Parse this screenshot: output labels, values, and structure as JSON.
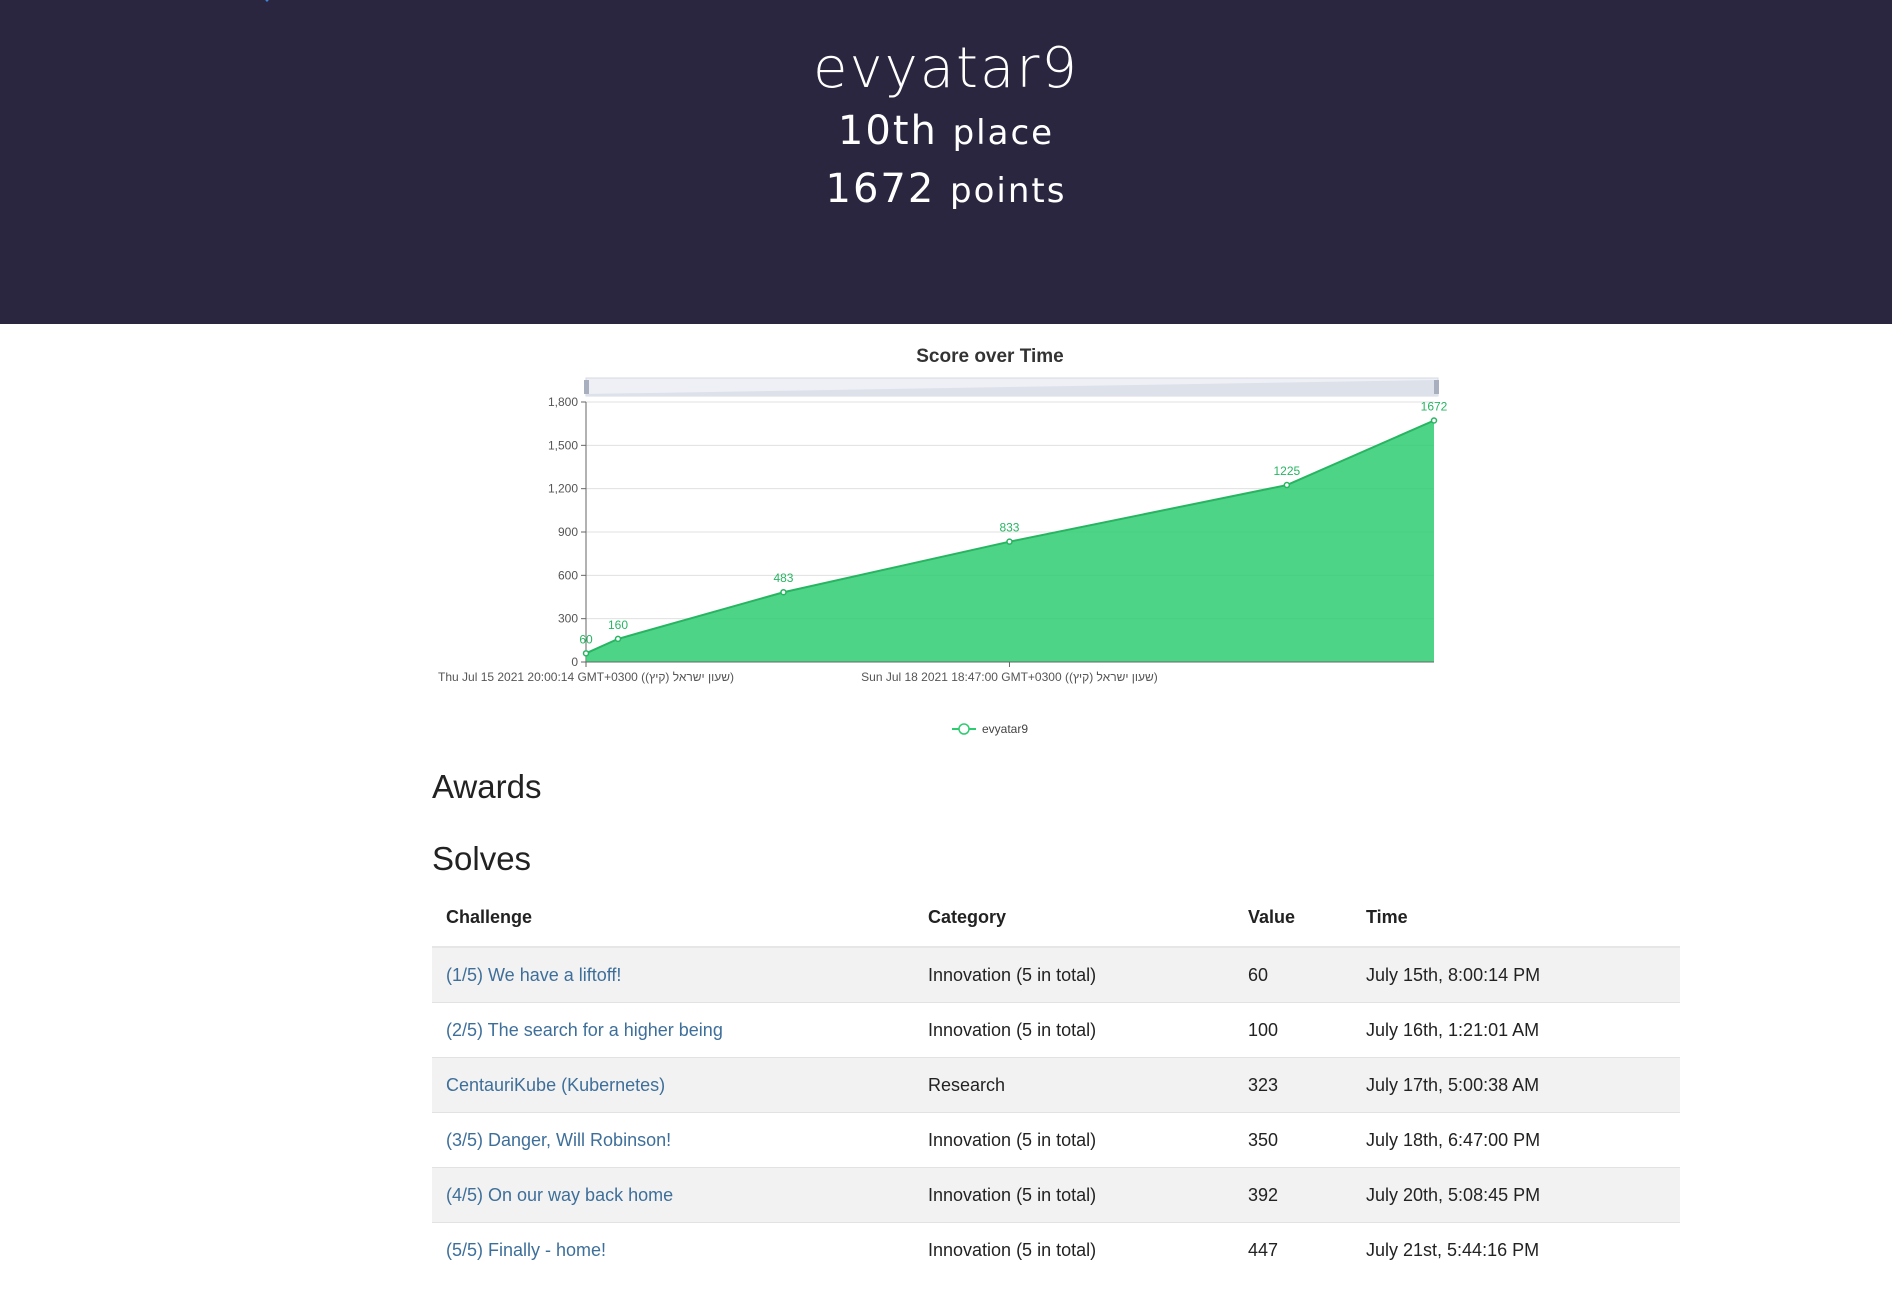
{
  "header": {
    "username": "evyatar9",
    "place_value": "10th",
    "place_word": "place",
    "points_value": "1672",
    "points_word": "points"
  },
  "colors": {
    "header_bg": "#2b2640",
    "series": "#2ecc71",
    "link": "#3e6f9a"
  },
  "chart_data": {
    "type": "area",
    "title": "Score over Time",
    "xlabel": "",
    "ylabel": "",
    "ylim": [
      0,
      1800
    ],
    "yticks": [
      "0",
      "300",
      "600",
      "900",
      "1,200",
      "1,500",
      "1,800"
    ],
    "xtick_labels": [
      "Thu Jul 15 2021 20:00:14 GMT+0300 (שעון ישראל (קיץ))",
      "Sun Jul 18 2021 18:47:00 GMT+0300 (שעון ישראל (קיץ))"
    ],
    "grid": true,
    "legend_position": "bottom",
    "has_zoom_slider": true,
    "series": [
      {
        "name": "evyatar9",
        "x": [
          "2021-07-15 20:00:14",
          "2021-07-16 01:21:01",
          "2021-07-17 05:00:38",
          "2021-07-18 18:47:00",
          "2021-07-20 17:08:45",
          "2021-07-21 17:44:16"
        ],
        "values": [
          60,
          160,
          483,
          833,
          1225,
          1672
        ],
        "labels": [
          "60",
          "160",
          "483",
          "833",
          "1225",
          "1672"
        ]
      }
    ]
  },
  "awards": {
    "heading": "Awards"
  },
  "solves": {
    "heading": "Solves",
    "columns": [
      "Challenge",
      "Category",
      "Value",
      "Time"
    ],
    "rows": [
      {
        "challenge": "(1/5) We have a liftoff!",
        "category": "Innovation (5 in total)",
        "value": "60",
        "time": "July 15th, 8:00:14 PM"
      },
      {
        "challenge": "(2/5) The search for a higher being",
        "category": "Innovation (5 in total)",
        "value": "100",
        "time": "July 16th, 1:21:01 AM"
      },
      {
        "challenge": "CentauriKube (Kubernetes)",
        "category": "Research",
        "value": "323",
        "time": "July 17th, 5:00:38 AM"
      },
      {
        "challenge": "(3/5) Danger, Will Robinson!",
        "category": "Innovation (5 in total)",
        "value": "350",
        "time": "July 18th, 6:47:00 PM"
      },
      {
        "challenge": "(4/5) On our way back home",
        "category": "Innovation (5 in total)",
        "value": "392",
        "time": "July 20th, 5:08:45 PM"
      },
      {
        "challenge": "(5/5) Finally - home!",
        "category": "Innovation (5 in total)",
        "value": "447",
        "time": "July 21st, 5:44:16 PM"
      }
    ]
  }
}
